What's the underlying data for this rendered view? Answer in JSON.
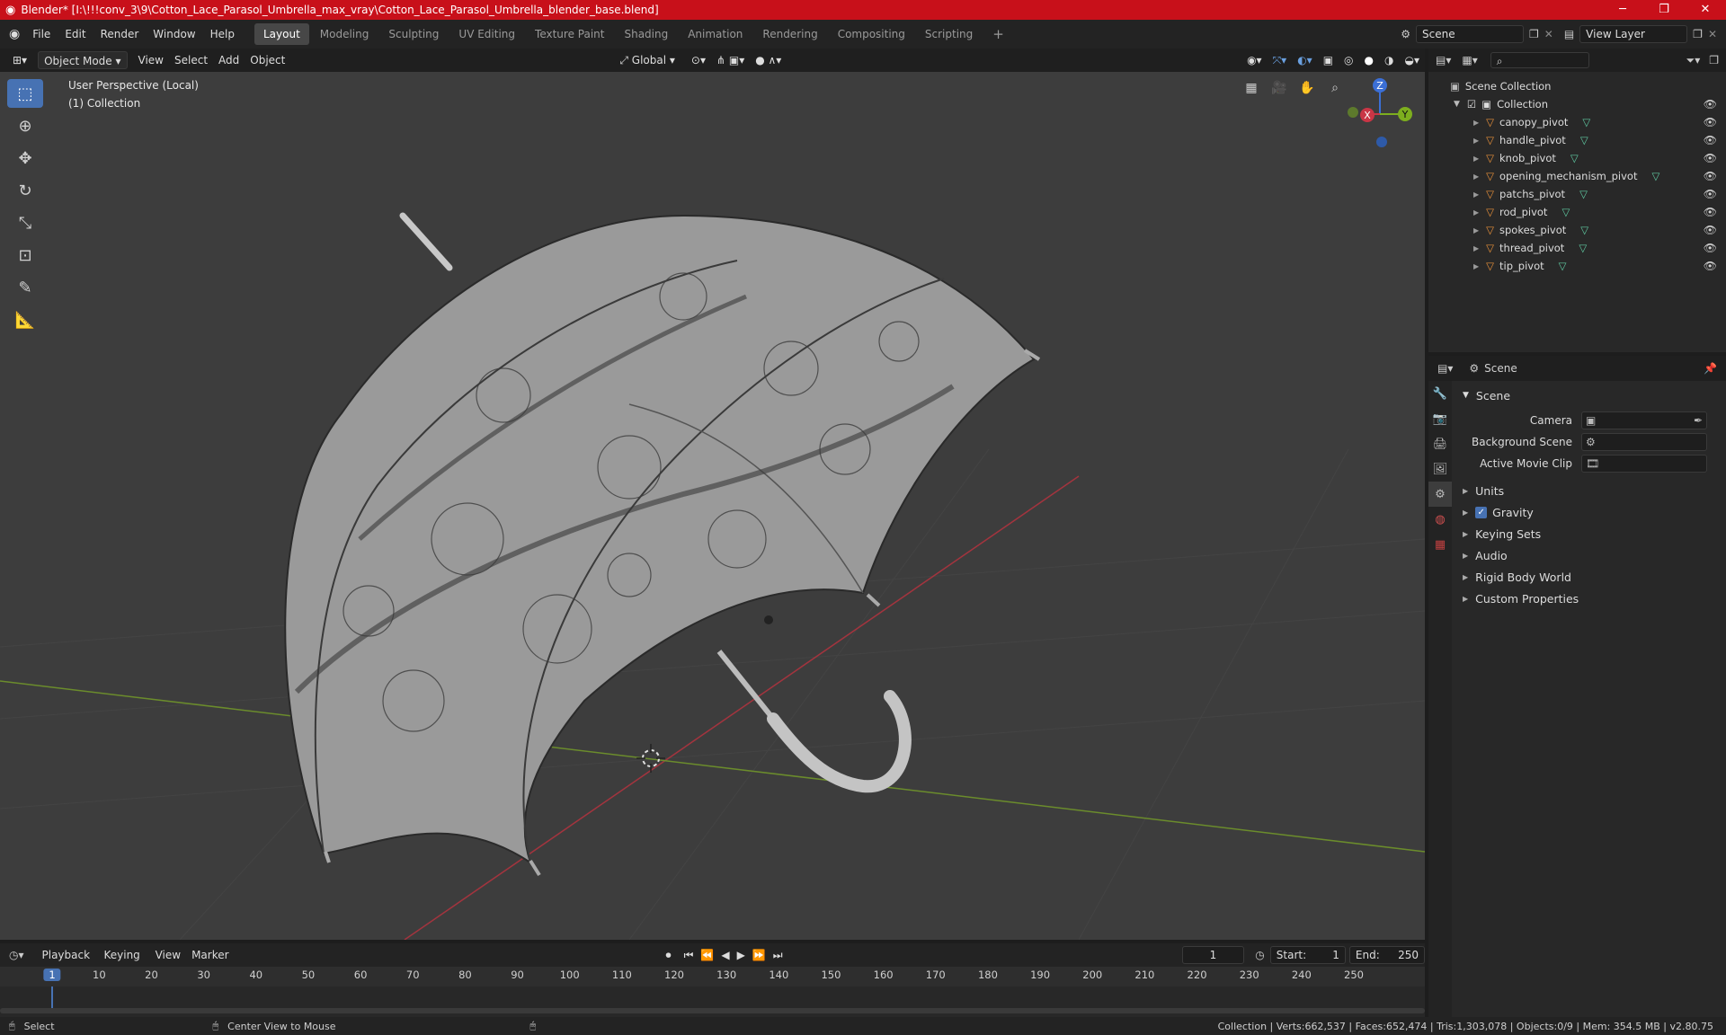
{
  "window": {
    "title": "Blender* [I:\\!!!conv_3\\9\\Cotton_Lace_Parasol_Umbrella_max_vray\\Cotton_Lace_Parasol_Umbrella_blender_base.blend]",
    "minimize": "─",
    "maximize": "❐",
    "close": "✕"
  },
  "menus": [
    "File",
    "Edit",
    "Render",
    "Window",
    "Help"
  ],
  "workspaces": [
    "Layout",
    "Modeling",
    "Sculpting",
    "UV Editing",
    "Texture Paint",
    "Shading",
    "Animation",
    "Rendering",
    "Compositing",
    "Scripting"
  ],
  "workspace_add": "+",
  "scene_field": "Scene",
  "view_layer_field": "View Layer",
  "viewport_header": {
    "mode": "Object Mode",
    "menus": [
      "View",
      "Select",
      "Add",
      "Object"
    ],
    "orientation": "Global"
  },
  "viewport": {
    "perspective_label": "User Perspective (Local)",
    "collection_label": "(1) Collection",
    "gizmo": {
      "x": "X",
      "y": "Y",
      "z": "Z"
    }
  },
  "outliner": {
    "root": "Scene Collection",
    "collection": "Collection",
    "items": [
      "canopy_pivot",
      "handle_pivot",
      "knob_pivot",
      "opening_mechanism_pivot",
      "patchs_pivot",
      "rod_pivot",
      "spokes_pivot",
      "thread_pivot",
      "tip_pivot"
    ]
  },
  "properties": {
    "context": "Scene",
    "section": "Scene",
    "fields": [
      {
        "label": "Camera"
      },
      {
        "label": "Background Scene"
      },
      {
        "label": "Active Movie Clip"
      }
    ],
    "subsections": [
      {
        "label": "Units",
        "checkbox": false
      },
      {
        "label": "Gravity",
        "checkbox": true
      },
      {
        "label": "Keying Sets",
        "checkbox": false
      },
      {
        "label": "Audio",
        "checkbox": false
      },
      {
        "label": "Rigid Body World",
        "checkbox": false
      },
      {
        "label": "Custom Properties",
        "checkbox": false
      }
    ]
  },
  "timeline": {
    "menus": [
      "Playback",
      "Keying",
      "View",
      "Marker"
    ],
    "current_frame": "1",
    "start_label": "Start:",
    "start": "1",
    "end_label": "End:",
    "end": "250",
    "ticks": [
      "1",
      "10",
      "20",
      "30",
      "40",
      "50",
      "60",
      "70",
      "80",
      "90",
      "100",
      "110",
      "120",
      "130",
      "140",
      "150",
      "160",
      "170",
      "180",
      "190",
      "200",
      "210",
      "220",
      "230",
      "240",
      "250"
    ]
  },
  "statusbar": {
    "left": "Select",
    "middle": "Center View to Mouse",
    "right": "Collection | Verts:662,537 | Faces:652,474 | Tris:1,303,078 | Objects:0/9 | Mem: 354.5 MB | v2.80.75"
  },
  "colors": {
    "title_bar": "#c8101a",
    "accent": "#4772b3",
    "mesh_icon": "#5fc7a0",
    "object_icon": "#e8903a"
  }
}
